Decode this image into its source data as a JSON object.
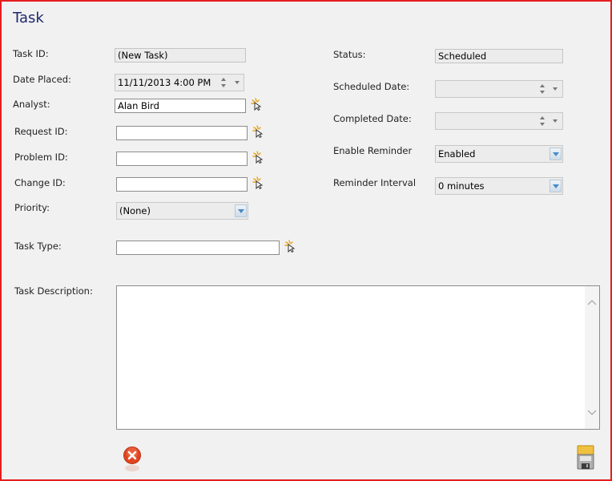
{
  "window": {
    "title": "Task"
  },
  "left_labels": {
    "task_id": "Task ID:",
    "date_placed": "Date Placed:",
    "analyst": "Analyst:",
    "request_id": "Request ID:",
    "problem_id": "Problem ID:",
    "change_id": "Change ID:",
    "priority": "Priority:",
    "task_type": "Task Type:",
    "task_description": "Task Description:"
  },
  "left_values": {
    "task_id": "(New Task)",
    "date_placed": "11/11/2013 4:00 PM",
    "analyst": "Alan Bird",
    "request_id": "",
    "problem_id": "",
    "change_id": "",
    "priority": "(None)",
    "task_type": "",
    "task_description": ""
  },
  "right_labels": {
    "status": "Status:",
    "scheduled_date": "Scheduled Date:",
    "completed_date": "Completed Date:",
    "enable_reminder": "Enable Reminder",
    "reminder_interval": "Reminder Interval"
  },
  "right_values": {
    "status": "Scheduled",
    "scheduled_date": "",
    "completed_date": "",
    "enable_reminder": "Enabled",
    "reminder_interval": "0 minutes"
  },
  "icons": {
    "lookup": "magic-wand-icon",
    "cancel": "red-x-circle-icon",
    "save": "floppy-disk-icon",
    "dropdown": "chevron-down-icon"
  },
  "colors": {
    "frame_border": "#e51d1d",
    "title": "#1d2a6b",
    "background": "#f1f1f1",
    "dropdown_arrow": "#4a8ac6",
    "cancel_red": "#e0451f"
  }
}
